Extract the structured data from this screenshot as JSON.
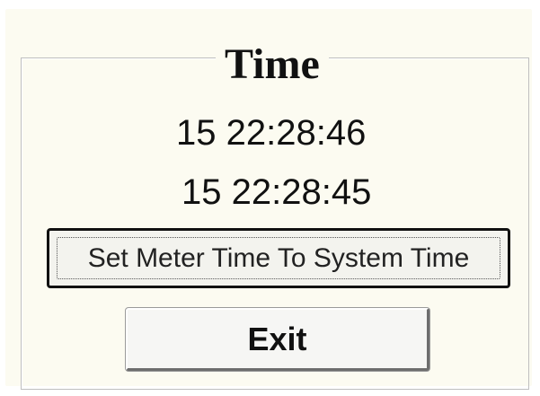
{
  "dialog": {
    "group_title": "Time",
    "meter_time": "15 22:28:46",
    "system_time": "15 22:28:45",
    "set_button_label": "Set Meter Time To System Time",
    "exit_button_label": "Exit"
  },
  "colors": {
    "panel_background": "#fcfbf1",
    "button_border": "#111111",
    "text": "#111111"
  }
}
